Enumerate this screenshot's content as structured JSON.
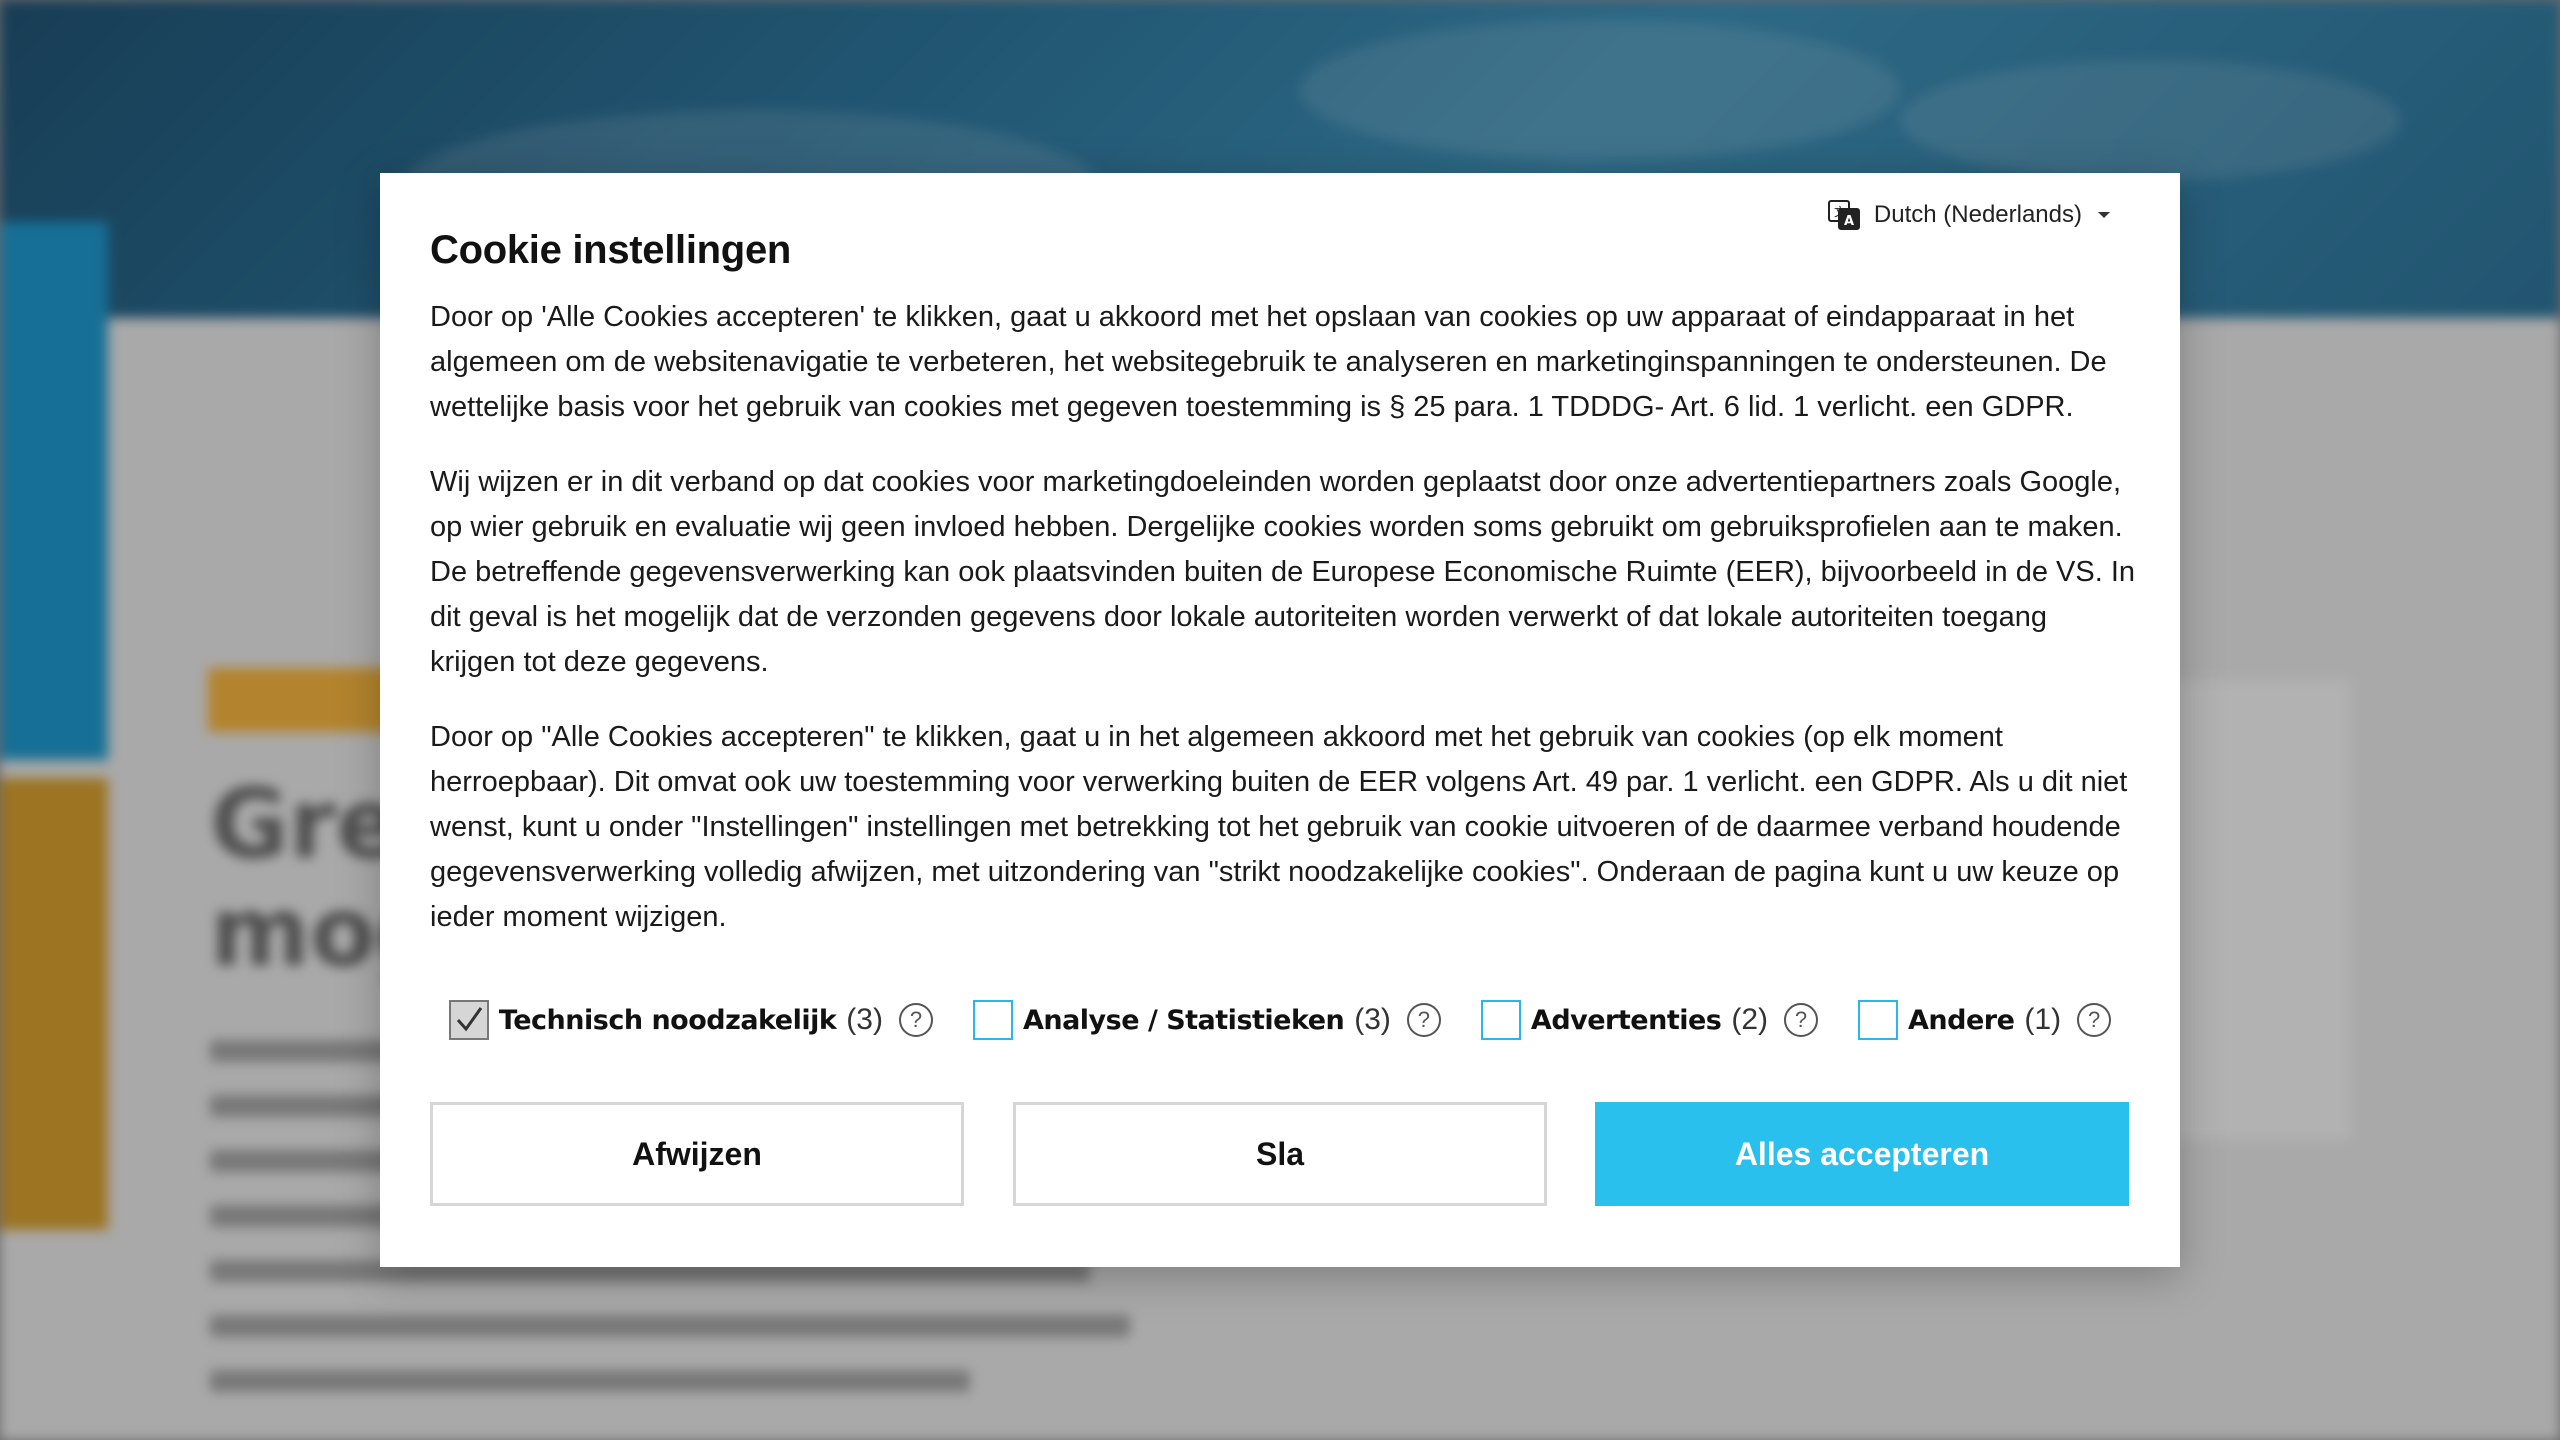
{
  "dialog": {
    "title": "Cookie instellingen",
    "language": {
      "label": "Dutch (Nederlands)",
      "icon": "translate-icon"
    },
    "paragraphs": [
      "Door op 'Alle Cookies accepteren' te klikken, gaat u akkoord met het opslaan van cookies op uw apparaat of eindapparaat in het algemeen om de websitenavigatie te verbeteren, het websitegebruik te analyseren en marketinginspanningen te ondersteunen. De wettelijke basis voor het gebruik van cookies met gegeven toestemming is § 25 para. 1 TDDDG- Art. 6 lid. 1 verlicht. een GDPR.",
      "Wij wijzen er in dit verband op dat cookies voor marketingdoeleinden worden geplaatst door onze advertentiepartners zoals Google, op wier gebruik en evaluatie wij geen invloed hebben. Dergelijke cookies worden soms gebruikt om gebruiksprofielen aan te maken. De betreffende gegevensverwerking kan ook plaatsvinden buiten de Europese Economische Ruimte (EER), bijvoorbeeld in de VS. In dit geval is het mogelijk dat de verzonden gegevens door lokale autoriteiten worden verwerkt of dat lokale autoriteiten toegang krijgen tot deze gegevens.",
      "Door op \"Alle Cookies accepteren\" te klikken, gaat u in het algemeen akkoord met het gebruik van cookies (op elk moment herroepbaar). Dit omvat ook uw toestemming voor verwerking buiten de EER volgens Art. 49 par. 1 verlicht. een GDPR. Als u dit niet wenst, kunt u onder \"Instellingen\" instellingen met betrekking tot het gebruik van cookie uitvoeren of de daarmee verband houdende gegevensverwerking volledig afwijzen, met uitzondering van \"strikt noodzakelijke cookies\". Onderaan de pagina kunt u uw keuze op ieder moment wijzigen."
    ],
    "categories": [
      {
        "label": "Technisch noodzakelijk",
        "count": "(3)",
        "checked": true
      },
      {
        "label": "Analyse / Statistieken",
        "count": "(3)",
        "checked": false
      },
      {
        "label": "Advertenties",
        "count": "(2)",
        "checked": false
      },
      {
        "label": "Andere",
        "count": "(1)",
        "checked": false
      }
    ],
    "help_glyph": "?",
    "buttons": {
      "reject": "Afwijzen",
      "save": "Sla",
      "accept": "Alles accepteren"
    }
  },
  "colors": {
    "accent": "#29c0ee",
    "checkbox_border": "#29b6e8",
    "header_bg": "#2b6f93"
  }
}
